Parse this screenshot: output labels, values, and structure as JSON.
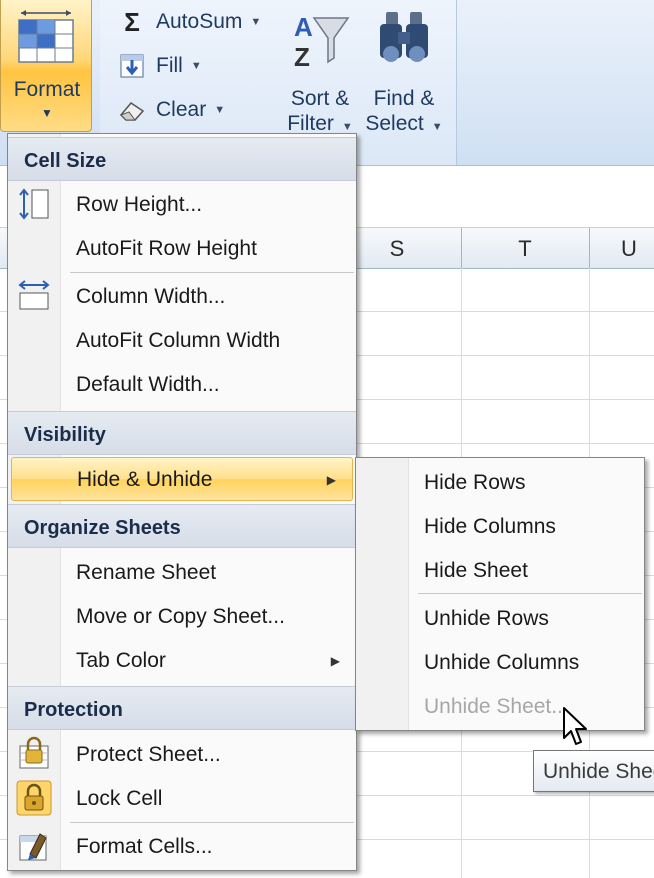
{
  "ribbon": {
    "format": {
      "label": "Format"
    },
    "autosum": {
      "label": "AutoSum"
    },
    "fill": {
      "label": "Fill"
    },
    "clear": {
      "label": "Clear"
    },
    "sort_filter": {
      "line1": "Sort &",
      "line2": "Filter"
    },
    "find_select": {
      "line1": "Find &",
      "line2": "Select"
    }
  },
  "columns": [
    "S",
    "T",
    "U"
  ],
  "menu": {
    "cell_size_header": "Cell Size",
    "row_height": "Row Height...",
    "autofit_row_height": "AutoFit Row Height",
    "column_width": "Column Width...",
    "autofit_column_width": "AutoFit Column Width",
    "default_width": "Default Width...",
    "visibility_header": "Visibility",
    "hide_unhide": "Hide & Unhide",
    "organize_header": "Organize Sheets",
    "rename_sheet": "Rename Sheet",
    "move_copy_sheet": "Move or Copy Sheet...",
    "tab_color": "Tab Color",
    "protection_header": "Protection",
    "protect_sheet": "Protect Sheet...",
    "lock_cell": "Lock Cell",
    "format_cells": "Format Cells..."
  },
  "submenu": {
    "hide_rows": "Hide Rows",
    "hide_columns": "Hide Columns",
    "hide_sheet": "Hide Sheet",
    "unhide_rows": "Unhide Rows",
    "unhide_columns": "Unhide Columns",
    "unhide_sheet": "Unhide Sheet..."
  },
  "tooltip": {
    "text": "Unhide Sheet"
  },
  "colors": {
    "highlight": "#ffd35c",
    "header_bg": "#d6dde8",
    "ribbon_bg": "#dbe7f6"
  }
}
